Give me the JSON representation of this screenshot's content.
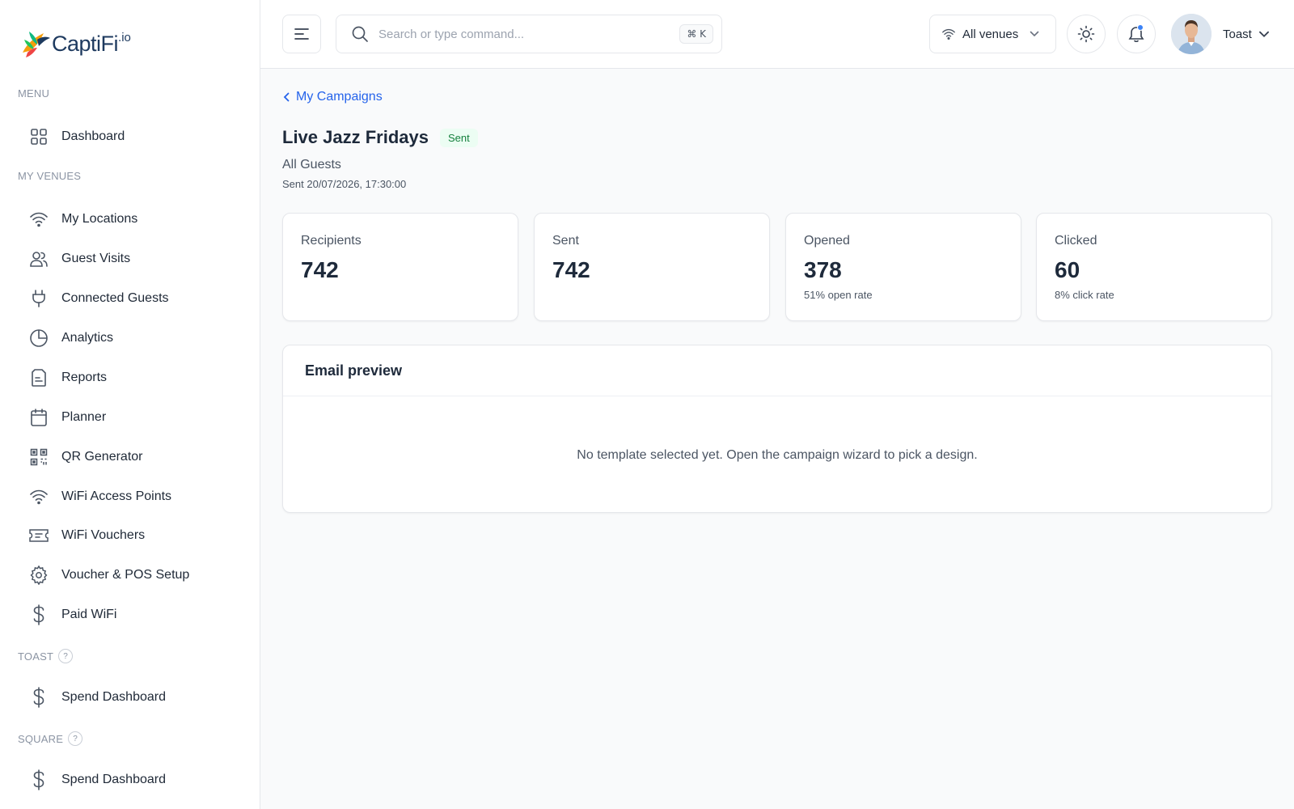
{
  "brand": {
    "name": "CaptiFi",
    "suffix": ".io"
  },
  "sidebar": {
    "sections": {
      "menu": "MENU",
      "my_venues": "MY VENUES",
      "toast": "TOAST",
      "square": "SQUARE"
    },
    "help_glyph": "?",
    "items": [
      {
        "label": "Dashboard",
        "icon": "grid-icon"
      },
      {
        "label": "My Locations",
        "icon": "wifi-icon"
      },
      {
        "label": "Guest Visits",
        "icon": "users-icon"
      },
      {
        "label": "Connected Guests",
        "icon": "plug-icon"
      },
      {
        "label": "Analytics",
        "icon": "pie-chart-icon"
      },
      {
        "label": "Reports",
        "icon": "document-icon"
      },
      {
        "label": "Planner",
        "icon": "calendar-icon"
      },
      {
        "label": "QR Generator",
        "icon": "qr-code-icon"
      },
      {
        "label": "WiFi Access Points",
        "icon": "wifi-icon"
      },
      {
        "label": "WiFi Vouchers",
        "icon": "ticket-icon"
      },
      {
        "label": "Voucher & POS Setup",
        "icon": "gear-icon"
      },
      {
        "label": "Paid WiFi",
        "icon": "dollar-icon"
      },
      {
        "label": "Spend Dashboard",
        "icon": "dollar-icon"
      },
      {
        "label": "Spend Dashboard",
        "icon": "dollar-icon"
      }
    ]
  },
  "header": {
    "search": {
      "placeholder": "Search or type command...",
      "shortcut": "⌘ K"
    },
    "venues_select": "All venues",
    "user_name": "Toast"
  },
  "main": {
    "back_link": "My Campaigns",
    "title": "Live Jazz Fridays",
    "status_badge": "Sent",
    "audience": "All Guests",
    "sent_at": "Sent 20/07/2026, 17:30:00",
    "stats": [
      {
        "label": "Recipients",
        "value": "742",
        "sub": ""
      },
      {
        "label": "Sent",
        "value": "742",
        "sub": ""
      },
      {
        "label": "Opened",
        "value": "378",
        "sub": "51% open rate"
      },
      {
        "label": "Clicked",
        "value": "60",
        "sub": "8% click rate"
      }
    ],
    "preview": {
      "title": "Email preview",
      "empty_message": "No template selected yet. Open the campaign wizard to pick a design."
    }
  },
  "colors": {
    "accent": "#2563eb",
    "badge_bg": "#ecfdf3",
    "badge_text": "#15803d",
    "notification_dot": "#3b82f6"
  }
}
